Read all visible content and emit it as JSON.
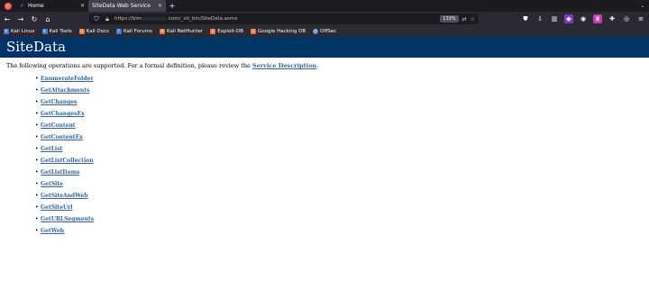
{
  "browser": {
    "tabs": [
      {
        "title": "Home",
        "active": false
      },
      {
        "title": "SiteData Web Service",
        "active": true
      }
    ],
    "url": {
      "prefix": "https://bim",
      "suffix": ".com/_vti_bin/SiteData.asmx"
    },
    "zoom": "133%",
    "bookmarks": [
      {
        "label": "Kali Linux",
        "icon": "kali-dragon-icon"
      },
      {
        "label": "Kali Tools",
        "icon": "kali-icon"
      },
      {
        "label": "Kali Docs",
        "icon": "kali-docs-icon"
      },
      {
        "label": "Kali Forums",
        "icon": "kali-forums-icon"
      },
      {
        "label": "Kali NetHunter",
        "icon": "nethunter-icon"
      },
      {
        "label": "Exploit-DB",
        "icon": "exploit-db-icon"
      },
      {
        "label": "Google Hacking DB",
        "icon": "ghdb-icon"
      },
      {
        "label": "OffSec",
        "icon": "offsec-icon"
      }
    ]
  },
  "page": {
    "title": "SiteData",
    "intro_text": "The following operations are supported. For a formal definition, please review the ",
    "intro_link": "Service Description",
    "intro_end": ".",
    "operations": [
      "EnumerateFolder",
      "GetAttachments",
      "GetChanges",
      "GetChangesEx",
      "GetContent",
      "GetContentEx",
      "GetList",
      "GetListCollection",
      "GetListItems",
      "GetSite",
      "GetSiteAndWeb",
      "GetSiteUrl",
      "GetURLSegments",
      "GetWeb"
    ]
  },
  "colors": {
    "header_bg": "#003366",
    "link": "#336699"
  }
}
